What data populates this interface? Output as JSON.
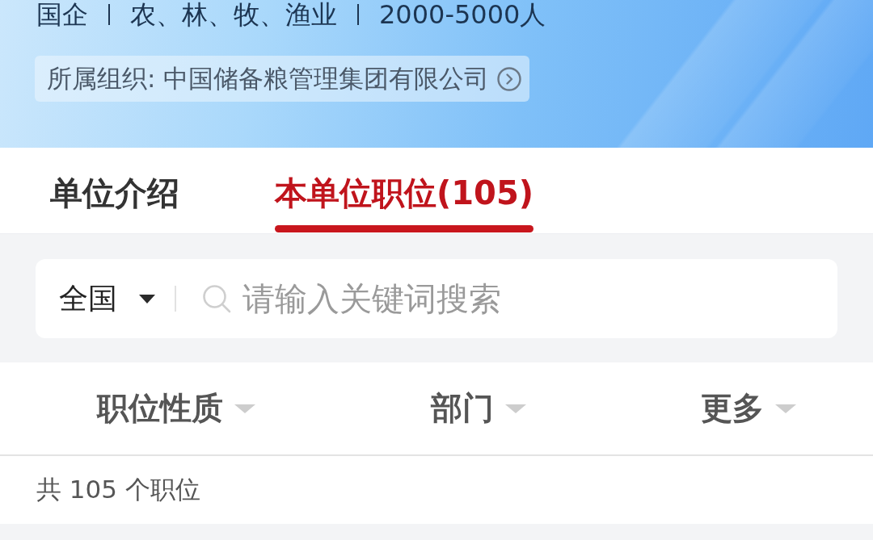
{
  "header": {
    "meta": [
      "国企",
      "农、林、牧、渔业",
      "2000-5000人"
    ],
    "organization": "所属组织: 中国储备粮管理集团有限公司"
  },
  "tabs": [
    {
      "label": "单位介绍",
      "selected": false
    },
    {
      "label": "本单位职位(105)",
      "selected": true
    }
  ],
  "search": {
    "region": "全国",
    "placeholder": "请输入关键词搜索"
  },
  "filters": [
    {
      "label": "职位性质"
    },
    {
      "label": "部门"
    },
    {
      "label": "更多"
    }
  ],
  "result_count": "共 105 个职位"
}
